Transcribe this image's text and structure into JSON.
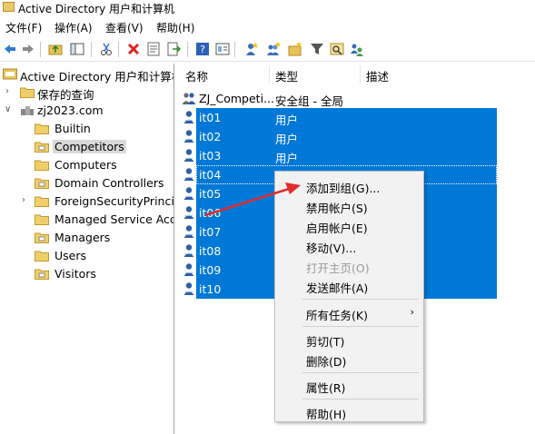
{
  "window": {
    "title": "Active Directory 用户和计算机"
  },
  "menubar": {
    "items": [
      "文件(F)",
      "操作(A)",
      "查看(V)",
      "帮助(H)"
    ]
  },
  "toolbar": {
    "icons": [
      "back-icon",
      "forward-icon",
      "folder-up-icon",
      "console-tree-icon",
      "cut-icon",
      "delete-icon",
      "properties-icon",
      "export-icon",
      "help-icon",
      "view-icon",
      "new-user-icon",
      "new-group-icon",
      "new-ou-icon",
      "filter-icon",
      "find-icon",
      "add-to-group-icon"
    ]
  },
  "tree": {
    "root": "Active Directory 用户和计算机",
    "saved_queries": "保存的查询",
    "domain": "zj2023.com",
    "children": [
      "Builtin",
      "Competitors",
      "Computers",
      "Domain Controllers",
      "ForeignSecurityPrincipals",
      "Managed Service Accounts",
      "Managers",
      "Users",
      "Visitors"
    ],
    "selected": "Competitors"
  },
  "list": {
    "columns": {
      "name": "名称",
      "type": "类型",
      "desc": "描述"
    },
    "rows": [
      {
        "name": "ZJ_Competi...",
        "type": "安全组 - 全局",
        "selected": false,
        "kind": "group"
      },
      {
        "name": "it01",
        "type": "用户",
        "selected": true,
        "kind": "user"
      },
      {
        "name": "it02",
        "type": "用户",
        "selected": true,
        "kind": "user"
      },
      {
        "name": "it03",
        "type": "用户",
        "selected": true,
        "kind": "user"
      },
      {
        "name": "it04",
        "type": "用户",
        "selected": true,
        "kind": "user"
      },
      {
        "name": "it05",
        "type": "",
        "selected": true,
        "kind": "user"
      },
      {
        "name": "it06",
        "type": "",
        "selected": true,
        "kind": "user"
      },
      {
        "name": "it07",
        "type": "",
        "selected": true,
        "kind": "user"
      },
      {
        "name": "it08",
        "type": "",
        "selected": true,
        "kind": "user"
      },
      {
        "name": "it09",
        "type": "",
        "selected": true,
        "kind": "user"
      },
      {
        "name": "it10",
        "type": "",
        "selected": true,
        "kind": "user"
      }
    ]
  },
  "context_menu": {
    "items": [
      {
        "label": "添加到组(G)...",
        "enabled": true
      },
      {
        "label": "禁用帐户(S)",
        "enabled": true
      },
      {
        "label": "启用帐户(E)",
        "enabled": true
      },
      {
        "label": "移动(V)...",
        "enabled": true
      },
      {
        "label": "打开主页(O)",
        "enabled": false
      },
      {
        "label": "发送邮件(A)",
        "enabled": true
      },
      {
        "label": "所有任务(K)",
        "enabled": true,
        "submenu": true
      },
      {
        "label": "剪切(T)",
        "enabled": true
      },
      {
        "label": "删除(D)",
        "enabled": true
      },
      {
        "label": "属性(R)",
        "enabled": true
      },
      {
        "label": "帮助(H)",
        "enabled": true
      }
    ],
    "submenu_arrow": "›"
  },
  "colors": {
    "selection": "#0078d7",
    "annotation_arrow": "#e32b2b"
  }
}
